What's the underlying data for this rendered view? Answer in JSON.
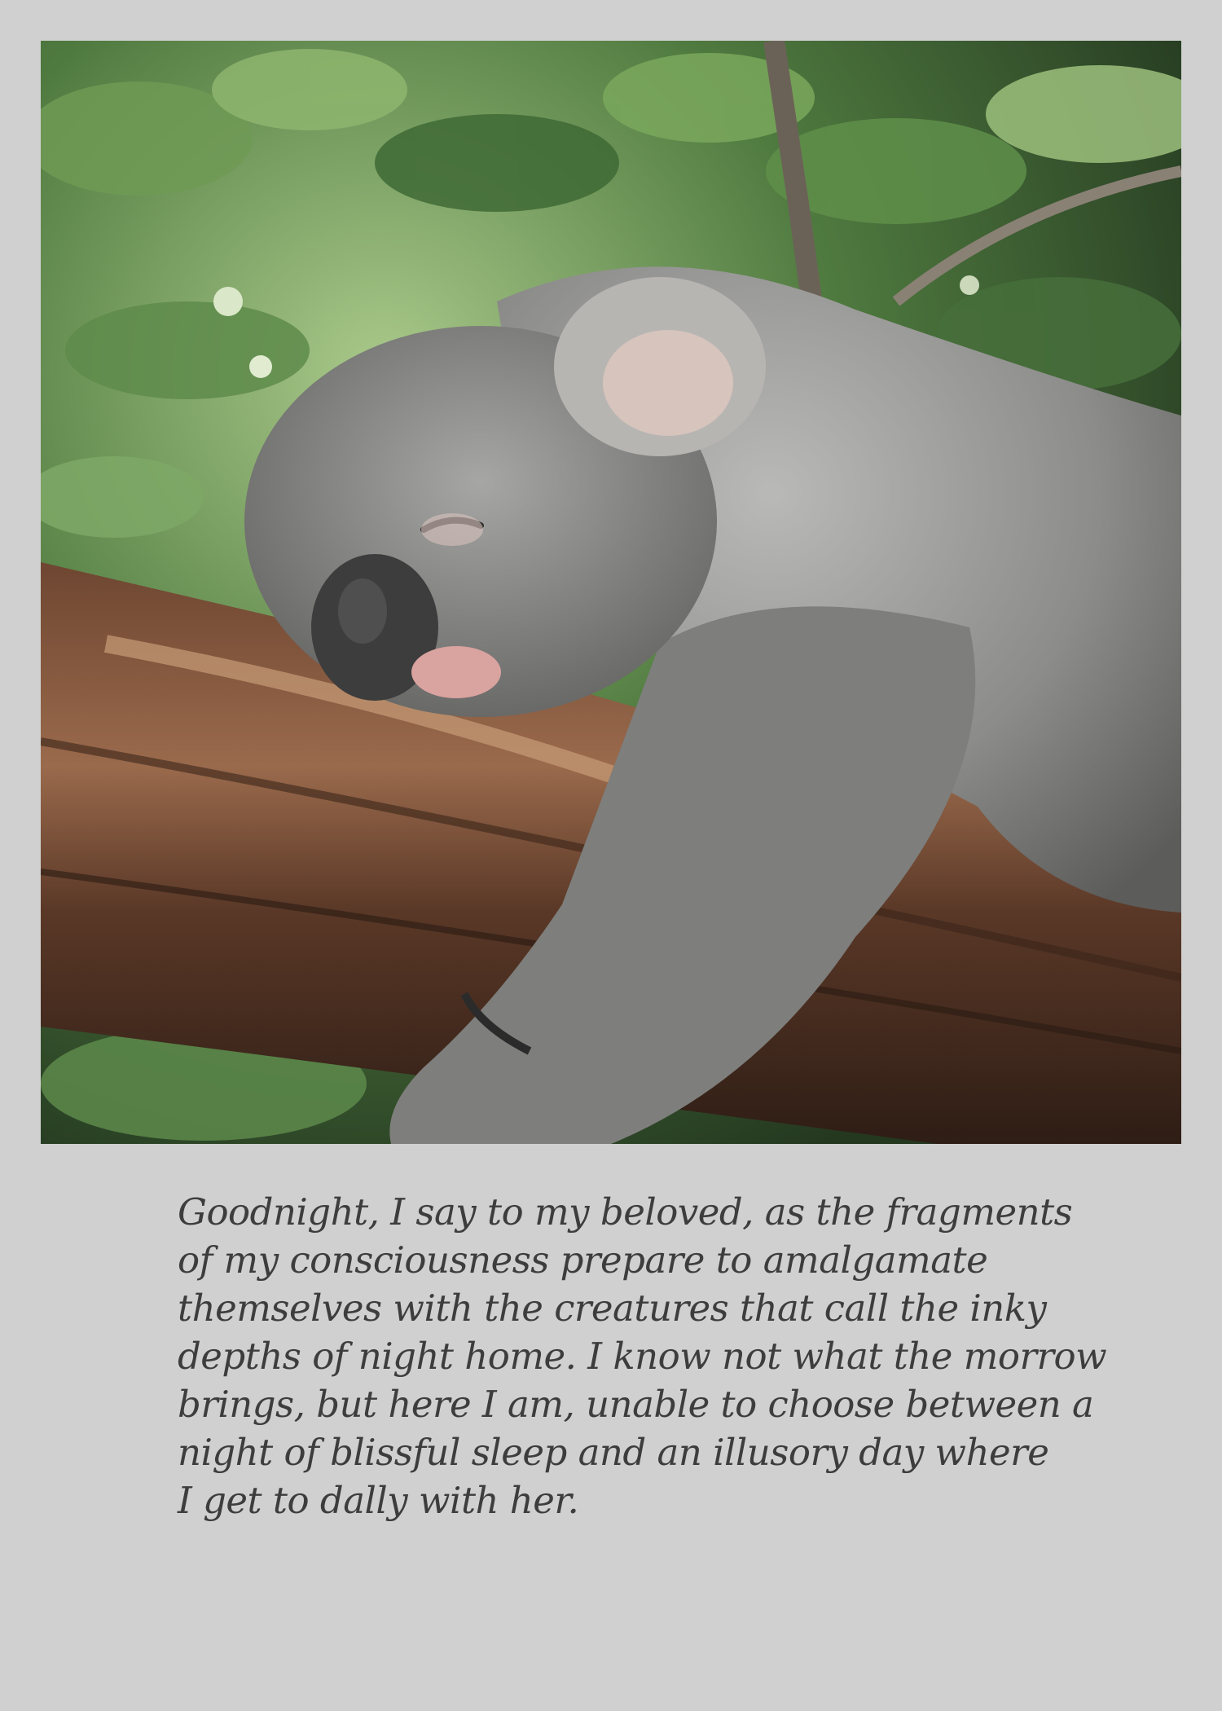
{
  "photo": {
    "subject-icon": "koala-sleeping-on-branch-photo",
    "colors": {
      "background": "#cfd0cf",
      "foliage": "#4f7a3f",
      "bark": "#5b3a2a",
      "fur": "#8a8a8a",
      "text": "#3d3d3d"
    }
  },
  "caption": {
    "lines": [
      "Goodnight, I say to my beloved, as the fragments",
      "of my consciousness prepare to amalgamate",
      "themselves with the creatures that call the inky",
      "depths of night home. I know not what the morrow",
      "brings, but here I am, unable to choose between a",
      "night of blissful sleep and an illusory day where",
      "I get to dally with her."
    ]
  }
}
